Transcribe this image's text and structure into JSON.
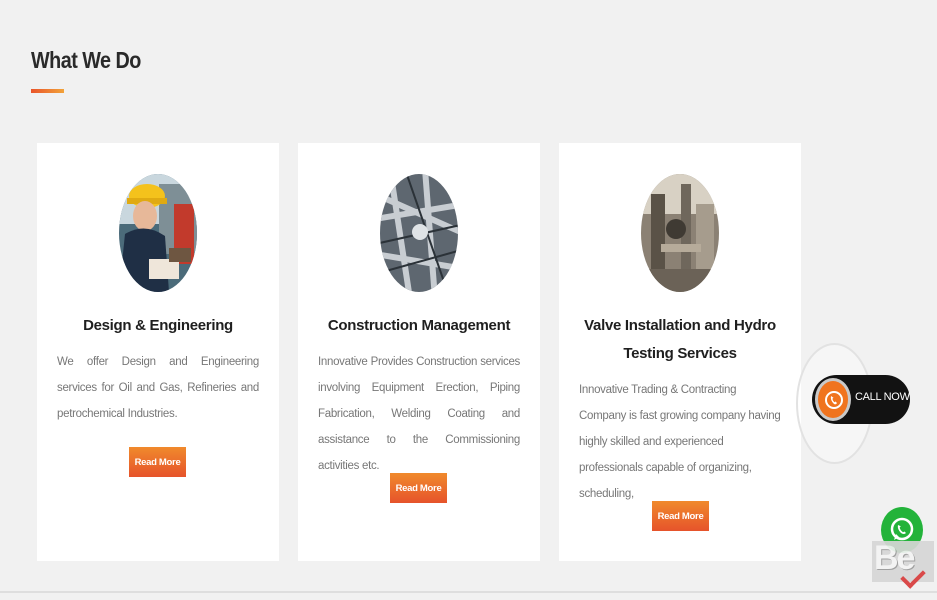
{
  "section": {
    "title": "What We Do"
  },
  "services": [
    {
      "title": "Design & Engineering",
      "description": "We offer Design and Engineering services for Oil and Gas, Refineries and petrochemical Industries.",
      "button_label": "Read More",
      "image_icon": "engineer-with-hard-hat-photo"
    },
    {
      "title": "Construction Management",
      "description": "Innovative Provides Construction services involving Equipment Erection, Piping Fabrication, Welding Coating and assistance to the Commissioning activities etc.",
      "button_label": "Read More",
      "image_icon": "industrial-pipes-photo"
    },
    {
      "title": "Valve Installation and Hydro Testing Services",
      "description": "Innovative Trading & Contracting Company is fast growing company having highly skilled and experienced professionals capable of organizing, scheduling,",
      "button_label": "Read More",
      "image_icon": "valve-machinery-photo"
    }
  ],
  "call_widget": {
    "label": "CALL NOW",
    "icon": "phone-icon"
  },
  "whatsapp": {
    "icon": "whatsapp-icon"
  },
  "watermark": {
    "text": "Be"
  },
  "colors": {
    "background": "#f1f1f1",
    "accent_orange": "#f08a2c",
    "accent_red": "#e6532b",
    "whatsapp_green": "#23b33a",
    "call_bar": "#121212"
  }
}
